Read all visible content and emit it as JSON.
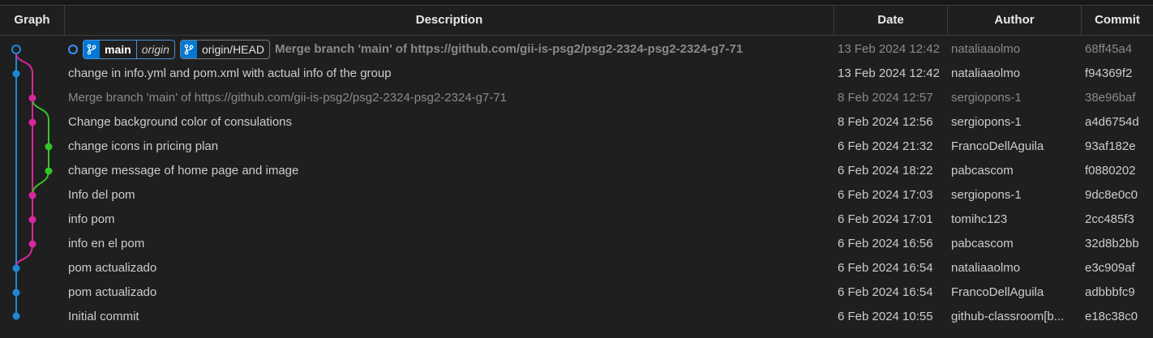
{
  "header": {
    "graph": "Graph",
    "description": "Description",
    "date": "Date",
    "author": "Author",
    "commit": "Commit"
  },
  "head_row": {
    "branch_name": "main",
    "branch_remote": "origin",
    "remote_ref": "origin/HEAD",
    "message": "Merge branch 'main' of https://github.com/gii-is-psg2/psg2-2324-psg2-2324-g7-71",
    "date": "13 Feb 2024 12:42",
    "author": "nataliaaolmo",
    "commit": "68ff45a4"
  },
  "commits": [
    {
      "message": "change in info.yml and pom.xml with actual info of the group",
      "date": "13 Feb 2024 12:42",
      "author": "nataliaaolmo",
      "commit": "f94369f2"
    },
    {
      "message": "Merge branch 'main' of https://github.com/gii-is-psg2/psg2-2324-psg2-2324-g7-71",
      "date": "8 Feb 2024 12:57",
      "author": "sergiopons-1",
      "commit": "38e96baf"
    },
    {
      "message": "Change background color of consulations",
      "date": "8 Feb 2024 12:56",
      "author": "sergiopons-1",
      "commit": "a4d6754d"
    },
    {
      "message": "change icons in pricing plan",
      "date": "6 Feb 2024 21:32",
      "author": "FrancoDellAguila",
      "commit": "93af182e"
    },
    {
      "message": "change message of home page and image",
      "date": "6 Feb 2024 18:22",
      "author": "pabcascom",
      "commit": "f0880202"
    },
    {
      "message": "Info del pom",
      "date": "6 Feb 2024 17:03",
      "author": "sergiopons-1",
      "commit": "9dc8e0c0"
    },
    {
      "message": "info pom",
      "date": "6 Feb 2024 17:01",
      "author": "tomihc123",
      "commit": "2cc485f3"
    },
    {
      "message": "info en el pom",
      "date": "6 Feb 2024 16:56",
      "author": "pabcascom",
      "commit": "32d8b2bb"
    },
    {
      "message": "pom actualizado",
      "date": "6 Feb 2024 16:54",
      "author": "nataliaaolmo",
      "commit": "e3c909af"
    },
    {
      "message": "pom actualizado",
      "date": "6 Feb 2024 16:54",
      "author": "FrancoDellAguila",
      "commit": "adbbbfc9"
    },
    {
      "message": "Initial commit",
      "date": "6 Feb 2024 10:55",
      "author": "github-classroom[b...",
      "commit": "e18c38c0"
    }
  ],
  "colors": {
    "lane_main": "#1e88d8",
    "lane_merge": "#d9269d",
    "lane_feature": "#35c426",
    "badge_bg": "#0078d4"
  },
  "icons": {
    "branch": "git-branch-icon",
    "head": "head-circle-icon"
  }
}
